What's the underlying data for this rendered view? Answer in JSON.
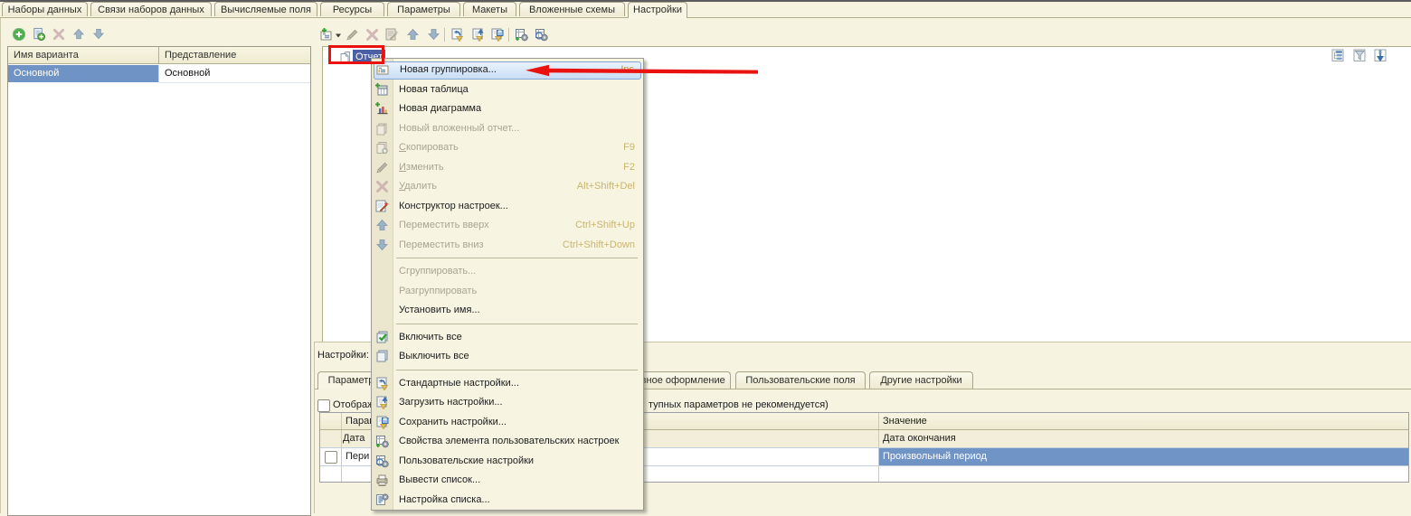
{
  "main_tabs": [
    {
      "label": "Наборы данных",
      "active": false
    },
    {
      "label": "Связи наборов данных",
      "active": false
    },
    {
      "label": "Вычисляемые поля",
      "active": false
    },
    {
      "label": "Ресурсы",
      "active": false
    },
    {
      "label": "Параметры",
      "active": false
    },
    {
      "label": "Макеты",
      "active": false
    },
    {
      "label": "Вложенные схемы",
      "active": false
    },
    {
      "label": "Настройки",
      "active": true
    }
  ],
  "variants_toolbar": [
    {
      "name": "add-button",
      "icon": "add-circle-icon",
      "enabled": true
    },
    {
      "name": "add-copy-button",
      "icon": "add-copy-icon",
      "enabled": true
    },
    {
      "name": "delete-button",
      "icon": "delete-x-icon",
      "enabled": false
    },
    {
      "name": "move-up-button",
      "icon": "arrow-up-icon",
      "enabled": false
    },
    {
      "name": "move-down-button",
      "icon": "arrow-down-icon",
      "enabled": false
    }
  ],
  "variants_table": {
    "columns": [
      "Имя варианта",
      "Представление"
    ],
    "rows": [
      {
        "name": "Основной",
        "presentation": "Основной",
        "selected": true
      }
    ]
  },
  "settings_toolbar": [
    {
      "name": "add-setting-button",
      "icon": "add-grouping-icon",
      "enabled": true,
      "has_dropdown": true
    },
    {
      "name": "edit-button",
      "icon": "pencil-icon",
      "enabled": false
    },
    {
      "name": "delete-button",
      "icon": "delete-x-icon",
      "enabled": false
    },
    {
      "name": "settings-constructor-button",
      "icon": "constructor-wand-icon",
      "enabled": false
    },
    {
      "name": "move-up-button",
      "icon": "arrow-up-icon",
      "enabled": false
    },
    {
      "name": "move-down-button",
      "icon": "arrow-down-icon",
      "enabled": false
    },
    {
      "sep": true
    },
    {
      "name": "standard-settings-button",
      "icon": "standard-settings-icon",
      "enabled": true
    },
    {
      "name": "load-settings-button",
      "icon": "load-settings-icon",
      "enabled": true
    },
    {
      "name": "save-settings-button",
      "icon": "save-settings-icon",
      "enabled": true
    },
    {
      "sep": true
    },
    {
      "name": "user-settings-item-properties-button",
      "icon": "user-settings-props-icon",
      "enabled": true
    },
    {
      "name": "user-settings-button",
      "icon": "user-settings-icon",
      "enabled": true
    }
  ],
  "tree": {
    "root_label": "Отчет",
    "corner_icons": [
      {
        "name": "structure-icon"
      },
      {
        "name": "filter-icon"
      },
      {
        "name": "order-icon"
      }
    ]
  },
  "context_menu": {
    "items": [
      {
        "label": "Новая группировка...",
        "shortcut": "Ins",
        "icon": "new-grouping-icon",
        "enabled": true,
        "highlighted": true
      },
      {
        "label": "Новая таблица",
        "icon": "new-table-icon",
        "enabled": true
      },
      {
        "label": "Новая диаграмма",
        "icon": "new-chart-icon",
        "enabled": true
      },
      {
        "label": "Новый вложенный отчет...",
        "icon": "new-nested-report-icon",
        "enabled": false
      },
      {
        "label": "Скопировать",
        "shortcut": "F9",
        "icon": "copy-icon",
        "enabled": false,
        "underline_first": true
      },
      {
        "label": "Изменить",
        "shortcut": "F2",
        "icon": "pencil-icon",
        "enabled": false,
        "underline_first": true
      },
      {
        "label": "Удалить",
        "shortcut": "Alt+Shift+Del",
        "icon": "delete-x-icon",
        "enabled": false,
        "underline_first": true
      },
      {
        "label": "Конструктор настроек...",
        "icon": "constructor-wand-icon",
        "enabled": true
      },
      {
        "label": "Переместить вверх",
        "shortcut": "Ctrl+Shift+Up",
        "icon": "arrow-up-icon",
        "enabled": false
      },
      {
        "label": "Переместить вниз",
        "shortcut": "Ctrl+Shift+Down",
        "icon": "arrow-down-icon",
        "enabled": false
      },
      {
        "sep": true
      },
      {
        "label": "Сгруппировать...",
        "enabled": false
      },
      {
        "label": "Разгруппировать",
        "enabled": false
      },
      {
        "label": "Установить имя...",
        "enabled": true
      },
      {
        "sep": true
      },
      {
        "label": "Включить все",
        "icon": "enable-all-icon",
        "enabled": true
      },
      {
        "label": "Выключить все",
        "icon": "disable-all-icon",
        "enabled": true
      },
      {
        "sep": true
      },
      {
        "label": "Стандартные настройки...",
        "icon": "standard-settings-icon",
        "enabled": true
      },
      {
        "label": "Загрузить настройки...",
        "icon": "load-settings-icon",
        "enabled": true
      },
      {
        "label": "Сохранить настройки...",
        "icon": "save-settings-icon",
        "enabled": true
      },
      {
        "label": "Свойства элемента пользовательских настроек",
        "icon": "user-settings-props-icon",
        "enabled": true
      },
      {
        "label": "Пользовательские настройки",
        "icon": "user-settings-icon",
        "enabled": true
      },
      {
        "label": "Вывести список...",
        "icon": "print-list-icon",
        "enabled": true
      },
      {
        "label": "Настройка списка...",
        "icon": "list-setup-icon",
        "enabled": true
      }
    ]
  },
  "settings_section": {
    "label": "Настройки:",
    "sub_tabs": [
      {
        "label": "Параметры",
        "active": true
      },
      {
        "label": "Условное оформление",
        "active": false
      },
      {
        "label": "Пользовательские поля",
        "active": false
      },
      {
        "label": "Другие настройки",
        "active": false
      }
    ],
    "show_unavailable_checkbox": {
      "checked": false,
      "label": "Отображать недоступные параметры (использование недоступных параметров не рекомендуется)",
      "label_visible_right_fragment": "тупных параметров не рекомендуется)"
    },
    "params_table": {
      "columns": [
        "Параметр",
        "Значение"
      ],
      "rows": [
        {
          "parameter": "Дата",
          "value": "Дата окончания",
          "selected": false
        },
        {
          "parameter": "Пери",
          "value": "Произвольный период",
          "selected": true,
          "has_checkbox": true,
          "checked": false
        }
      ]
    }
  },
  "annotations": {
    "red_box_target": "Отчет",
    "red_arrow_target": "Новая группировка..."
  },
  "colors": {
    "background": "#f6f3e1",
    "selection_blue": "#7094c5",
    "tree_selection_blue": "#4b5fa5",
    "menu_highlight_border": "#82a7d8",
    "shortcut_gold": "#bd9a35",
    "annotation_red": "#e9120f"
  }
}
